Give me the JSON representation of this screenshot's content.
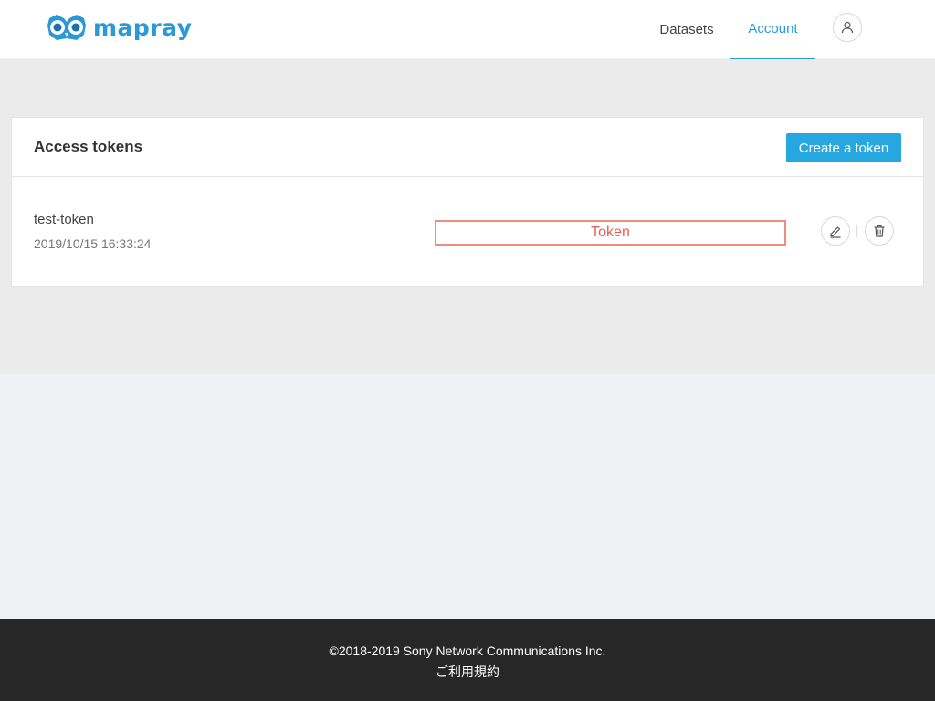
{
  "header": {
    "logo_text": "mapray",
    "nav": {
      "datasets_label": "Datasets",
      "account_label": "Account"
    },
    "user_icon": "user-icon"
  },
  "colors": {
    "brand": "#2a9ad6",
    "primary_button": "#27a7df",
    "token_highlight": "#f08a82",
    "footer_bg": "#272727"
  },
  "card": {
    "title": "Access tokens",
    "create_button_label": "Create a token",
    "tokens": [
      {
        "name": "test-token",
        "created": "2019/10/15 16:33:24",
        "token_value": "Token",
        "actions": [
          "pencil-icon",
          "trash-icon"
        ]
      }
    ]
  },
  "footer": {
    "copyright": "©2018-2019 Sony Network Communications Inc.",
    "terms_label": "ご利用規約"
  }
}
